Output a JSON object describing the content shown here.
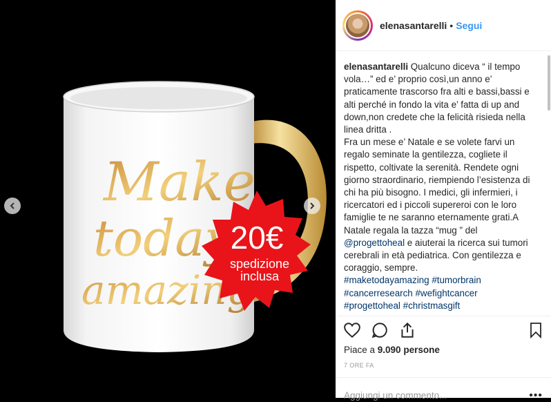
{
  "post": {
    "image_overlay": {
      "mug_text_line1": "Make",
      "mug_text_line2": "today",
      "mug_text_line3": "amazing",
      "badge_price": "20€",
      "badge_line1": "spedizione",
      "badge_line2": "inclusa"
    },
    "nav_prev_icon": "chevron-left-icon",
    "nav_next_icon": "chevron-right-icon"
  },
  "header": {
    "username": "elenasantarelli",
    "separator": "•",
    "follow_label": "Segui"
  },
  "caption": {
    "username": "elenasantarelli",
    "text_part1": " Qualcuno diceva “ il tempo vola…” ed e’ proprio così,un anno e’ praticamente trascorso fra alti e bassi,bassi e alti perché in fondo la vita e’ fatta di up and down,non credete che la felicità risieda nella linea dritta .\nFra un mese e’ Natale e se volete farvi un regalo seminate la gentilezza, cogliete il rispetto, coltivate la serenità. Rendete ogni giorno straordinario, riempiendo l’esistenza di chi ha più bisogno. I medici, gli infermieri, i ricercatori ed i piccoli supereroi con le loro famiglie te ne saranno eternamente grati.A Natale regala la tazza “mug ” del ",
    "mention": "@progettoheal",
    "text_part2": " e aiuterai la ricerca sui tumori cerebrali in età pediatrica. Con gentilezza e coraggio, sempre.\n",
    "hashtags": [
      "#maketodayamazing",
      "#tumorbrain",
      "#cancerresearch",
      "#wefightcancer",
      "#progettoheal",
      "#christmasgift"
    ]
  },
  "actions": {
    "like_icon": "heart-icon",
    "comment_icon": "comment-icon",
    "share_icon": "share-icon",
    "save_icon": "bookmark-icon"
  },
  "likes": {
    "prefix": "Piace a ",
    "count": "9.090",
    "suffix": " persone"
  },
  "timestamp": "7 ORE FA",
  "comment": {
    "placeholder": "Aggiungi un commento...",
    "more_label": "•••"
  },
  "colors": {
    "follow_blue": "#3897f0",
    "link_blue": "#003569",
    "badge_red": "#e8141a",
    "mug_gold": "#d9a24a"
  }
}
